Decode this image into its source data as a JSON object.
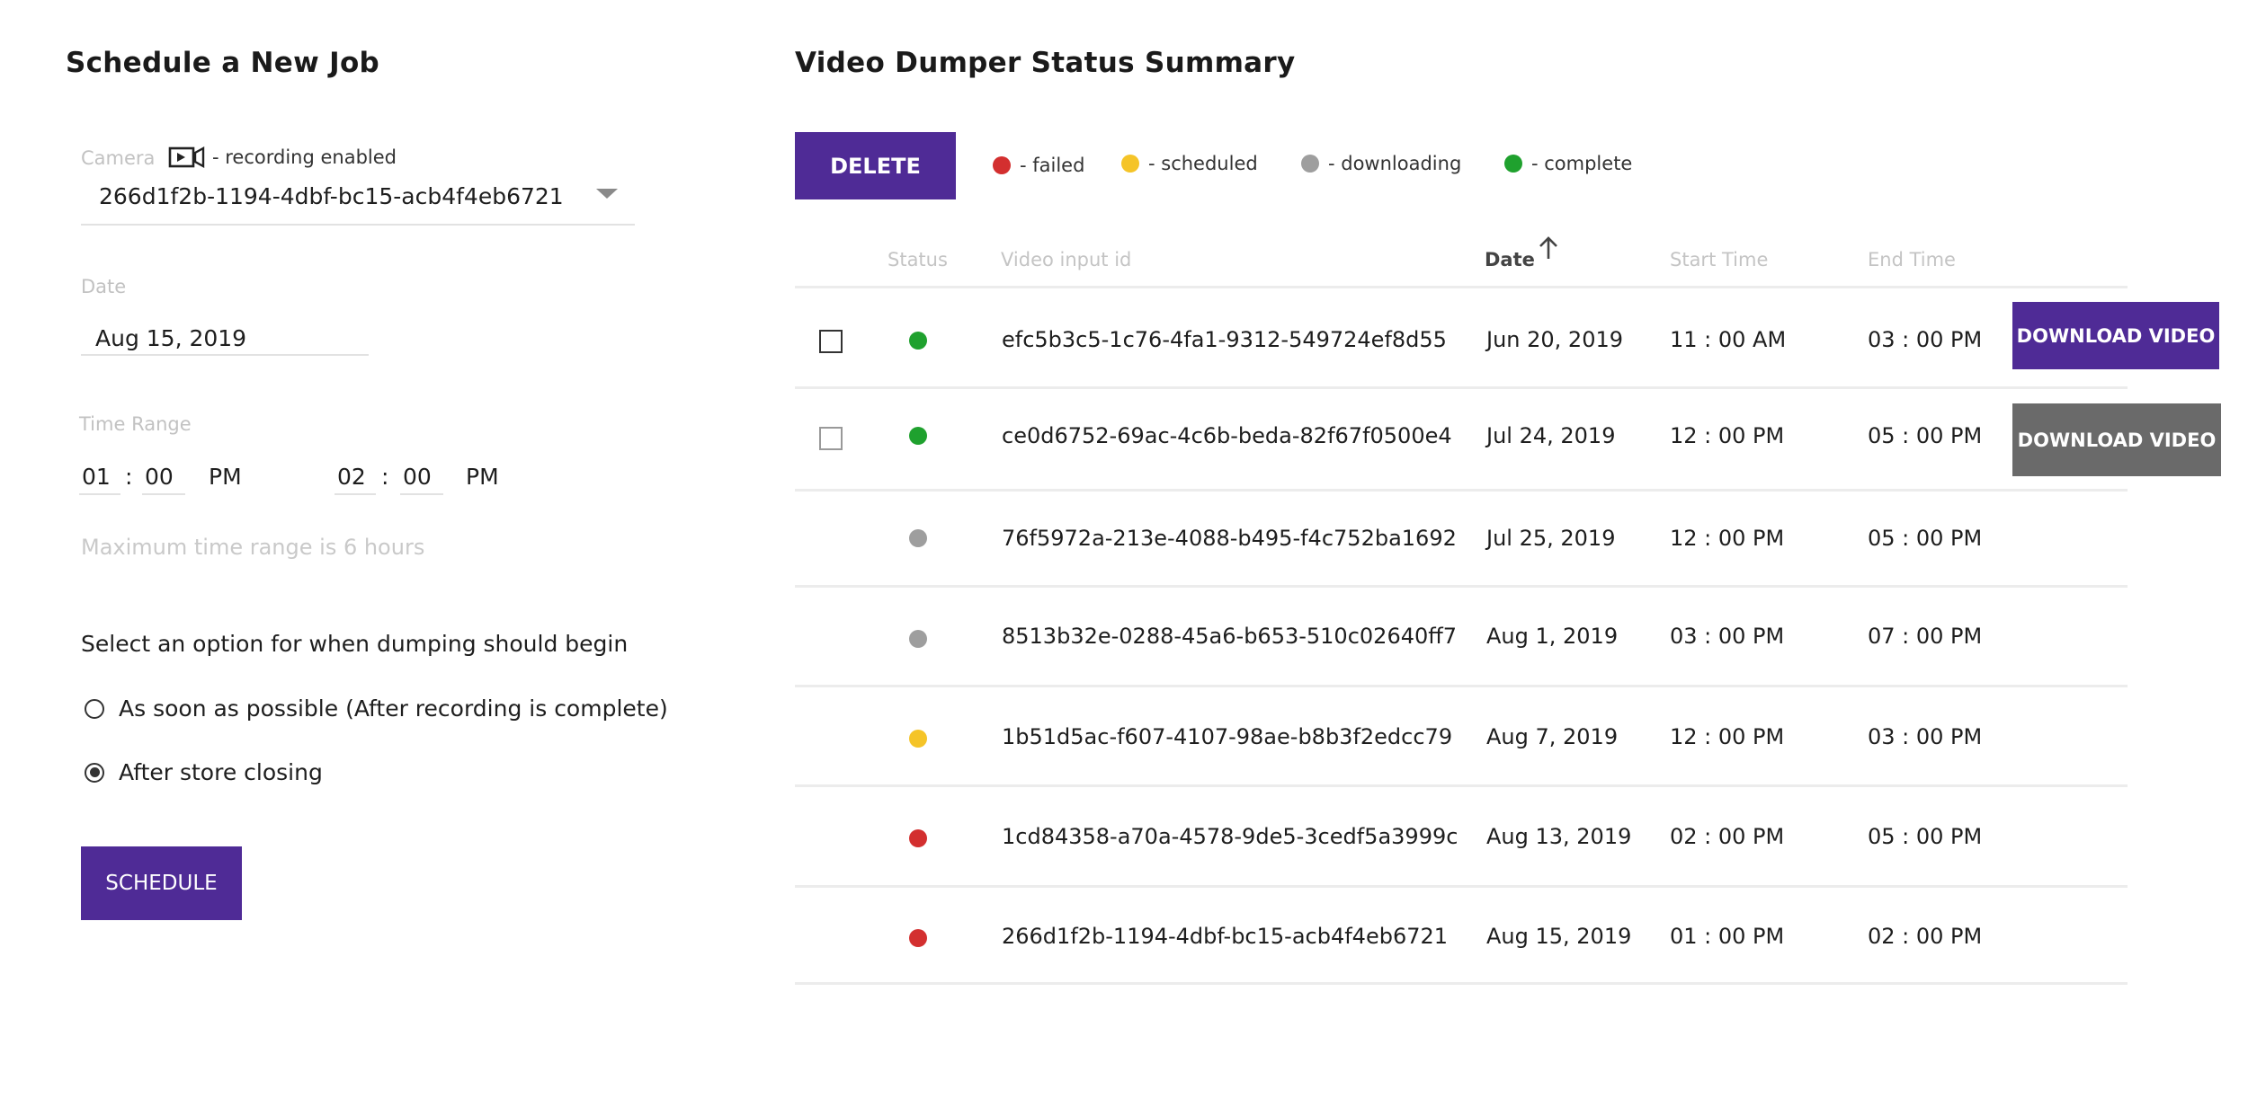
{
  "left": {
    "title": "Schedule a New Job",
    "camera": {
      "label": "Camera",
      "recording_note": "- recording enabled",
      "icon": "video-camera-icon",
      "value": "266d1f2b-1194-4dbf-bc15-acb4f4eb6721"
    },
    "date": {
      "label": "Date",
      "value": "Aug 15, 2019"
    },
    "time_range": {
      "label": "Time Range",
      "start": {
        "hour": "01",
        "minute": "00",
        "ampm": "PM"
      },
      "end": {
        "hour": "02",
        "minute": "00",
        "ampm": "PM"
      },
      "separator": ":",
      "hint": "Maximum time range is 6 hours"
    },
    "option_prompt": "Select an option for when dumping should begin",
    "options": [
      {
        "label": "As soon as possible (After recording is complete)",
        "selected": false
      },
      {
        "label": "After store closing",
        "selected": true
      }
    ],
    "schedule_label": "SCHEDULE"
  },
  "right": {
    "title": "Video Dumper Status Summary",
    "delete_label": "DELETE",
    "legend": [
      {
        "label": "- failed",
        "color": "#d32f2f"
      },
      {
        "label": "- scheduled",
        "color": "#f5c428"
      },
      {
        "label": "- downloading",
        "color": "#9e9e9e"
      },
      {
        "label": "- complete",
        "color": "#1fa12e"
      }
    ],
    "columns": [
      "Status",
      "Video input id",
      "Date",
      "Start Time",
      "End Time"
    ],
    "sort_icon": "arrow-up-icon",
    "download_label": "DOWNLOAD VIDEO",
    "rows": [
      {
        "status": "complete",
        "color": "#1fa12e",
        "id": "efc5b3c5-1c76-4fa1-9312-549724ef8d55",
        "date": "Jun 20, 2019",
        "start": "11 : 00 AM",
        "end": "03 : 00 PM",
        "checkbox": true,
        "download": true
      },
      {
        "status": "complete",
        "color": "#1fa12e",
        "id": "ce0d6752-69ac-4c6b-beda-82f67f0500e4",
        "date": "Jul 24, 2019",
        "start": "12 : 00 PM",
        "end": "05 : 00 PM",
        "checkbox": true,
        "download": true
      },
      {
        "status": "downloading",
        "color": "#9e9e9e",
        "id": "76f5972a-213e-4088-b495-f4c752ba1692",
        "date": "Jul 25, 2019",
        "start": "12 : 00 PM",
        "end": "05 : 00 PM",
        "checkbox": false,
        "download": false
      },
      {
        "status": "downloading",
        "color": "#9e9e9e",
        "id": "8513b32e-0288-45a6-b653-510c02640ff7",
        "date": "Aug 1, 2019",
        "start": "03 : 00 PM",
        "end": "07 : 00 PM",
        "checkbox": false,
        "download": false
      },
      {
        "status": "scheduled",
        "color": "#f5c428",
        "id": "1b51d5ac-f607-4107-98ae-b8b3f2edcc79",
        "date": "Aug 7, 2019",
        "start": "12 : 00 PM",
        "end": "03 : 00 PM",
        "checkbox": false,
        "download": false
      },
      {
        "status": "failed",
        "color": "#d32f2f",
        "id": "1cd84358-a70a-4578-9de5-3cedf5a3999c",
        "date": "Aug 13, 2019",
        "start": "02 : 00 PM",
        "end": "05 : 00 PM",
        "checkbox": false,
        "download": false
      },
      {
        "status": "failed",
        "color": "#d32f2f",
        "id": "266d1f2b-1194-4dbf-bc15-acb4f4eb6721",
        "date": "Aug 15, 2019",
        "start": "01 : 00 PM",
        "end": "02 : 00 PM",
        "checkbox": false,
        "download": false
      }
    ]
  },
  "colors": {
    "primary": "#4f2b96",
    "download_active": "#4f2b96",
    "download_hover": "#6a6a6a"
  }
}
